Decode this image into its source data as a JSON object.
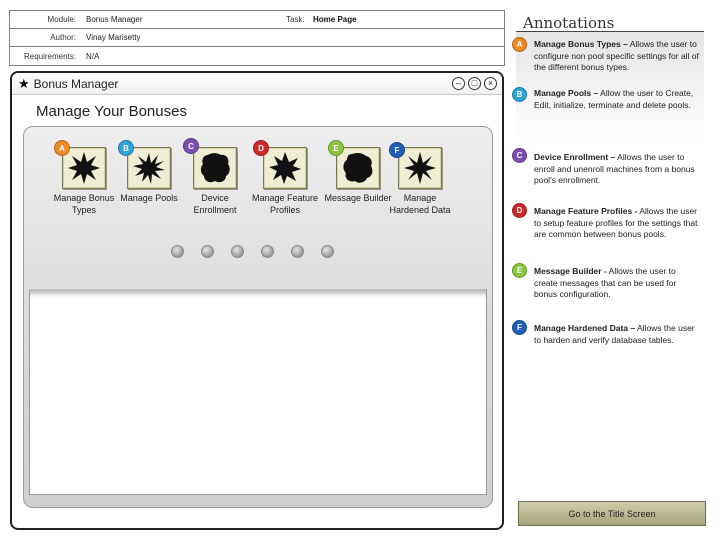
{
  "header": {
    "module_label": "Module:",
    "module_value": "Bonus Manager",
    "task_label": "Task:",
    "task_value": "Home Page",
    "author_label": "Author:",
    "author_value": "Vinay Marisetty",
    "requirements_label": "Requirements:",
    "requirements_value": "N/A"
  },
  "window": {
    "title": "Bonus Manager",
    "controls": {
      "minimize": "–",
      "restore": "□",
      "close": "×"
    }
  },
  "page": {
    "title": "Manage Your Bonuses"
  },
  "items": [
    {
      "badge": "A",
      "label": "Manage Bonus Types",
      "badge_color": "#f08a24",
      "icon": "star-burst-icon"
    },
    {
      "badge": "B",
      "label": "Manage Pools",
      "badge_color": "#2fa3d8",
      "icon": "star-burst-icon"
    },
    {
      "badge": "C",
      "label": "Device Enrollment",
      "badge_color": "#7a4fb0",
      "icon": "blob-icon"
    },
    {
      "badge": "D",
      "label": "Manage Feature Profiles",
      "badge_color": "#cc2a2a",
      "icon": "star-burst-icon"
    },
    {
      "badge": "E",
      "label": "Message Builder",
      "badge_color": "#8cc63f",
      "icon": "blob-icon"
    },
    {
      "badge": "F",
      "label": "Manage Hardened Data",
      "badge_color": "#1f5fb8",
      "icon": "star-burst-icon"
    }
  ],
  "annotations": {
    "heading": "Annotations",
    "entries": [
      {
        "badge": "A",
        "title": "Manage Bonus Types –",
        "text": "Allows the user to configure non pool specific settings for all of the different bonus types."
      },
      {
        "badge": "B",
        "title": "Manage Pools –",
        "text": "Allow the user to Create, Edit, initialize, terminate and delete pools."
      },
      {
        "badge": "C",
        "title": "Device Enrollment –",
        "text": "Allows the user to enroll and unenroll machines from a bonus pool's enrollment."
      },
      {
        "badge": "D",
        "title": "Manage Feature Profiles -",
        "text": "Allows the user to setup feature profiles for the settings that are common between bonus pools."
      },
      {
        "badge": "E",
        "title": "Message Builder -",
        "text": "Allows the user to create messages that can be used for bonus configuration."
      },
      {
        "badge": "F",
        "title": "Manage Hardened Data –",
        "text": "Allows the user to harden and verify database tables."
      }
    ]
  },
  "footer": {
    "title_screen_button": "Go to the Title Screen"
  }
}
